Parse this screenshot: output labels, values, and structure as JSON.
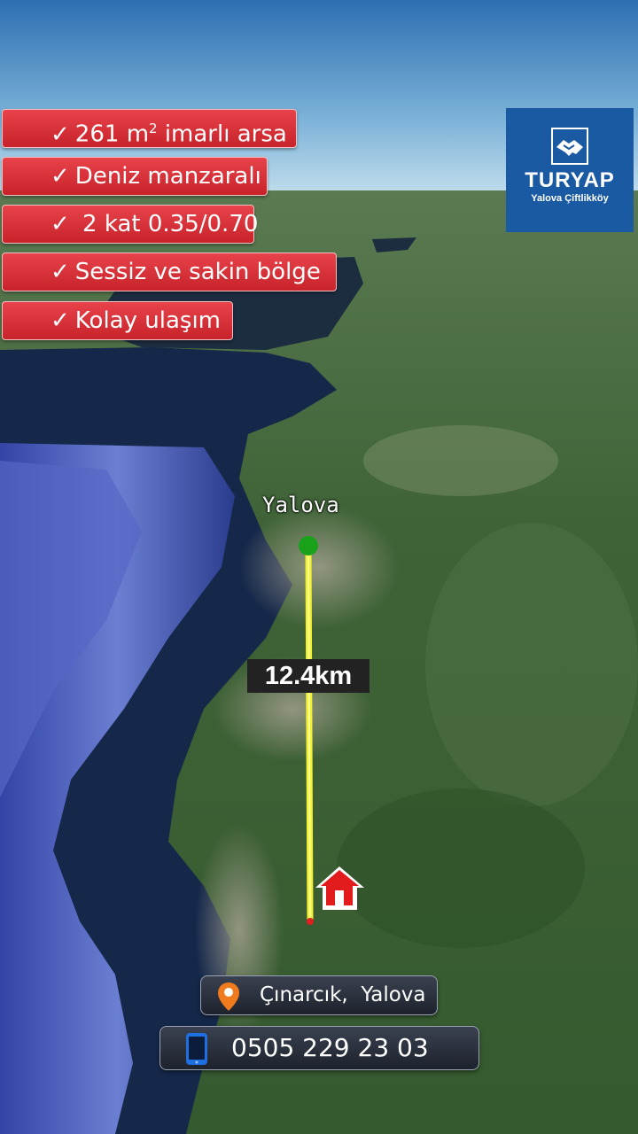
{
  "features": [
    {
      "check": "✓",
      "text": "261 m",
      "sup": "2",
      "suffix": " imarlı arsa"
    },
    {
      "check": "✓",
      "text": "Deniz manzaralı"
    },
    {
      "check": "✓",
      "text": " 2 kat 0.35/0.70"
    },
    {
      "check": "✓",
      "text": "Sessiz ve sakin bölge"
    },
    {
      "check": "✓",
      "text": "Kolay ulaşım"
    }
  ],
  "logo": {
    "brand": "TURYAP",
    "branch": "Yalova Çiftlikköy"
  },
  "map": {
    "origin_label": "Yalova",
    "distance_label": "12.4km",
    "colors": {
      "route": "#f2f230",
      "origin_marker": "#1aa11a",
      "destination_marker": "#e02020"
    }
  },
  "location": {
    "icon": "map-pin-icon",
    "text": "Çınarcık,  Yalova"
  },
  "contact": {
    "icon": "phone-icon",
    "phone": "0505 229 23 03"
  }
}
